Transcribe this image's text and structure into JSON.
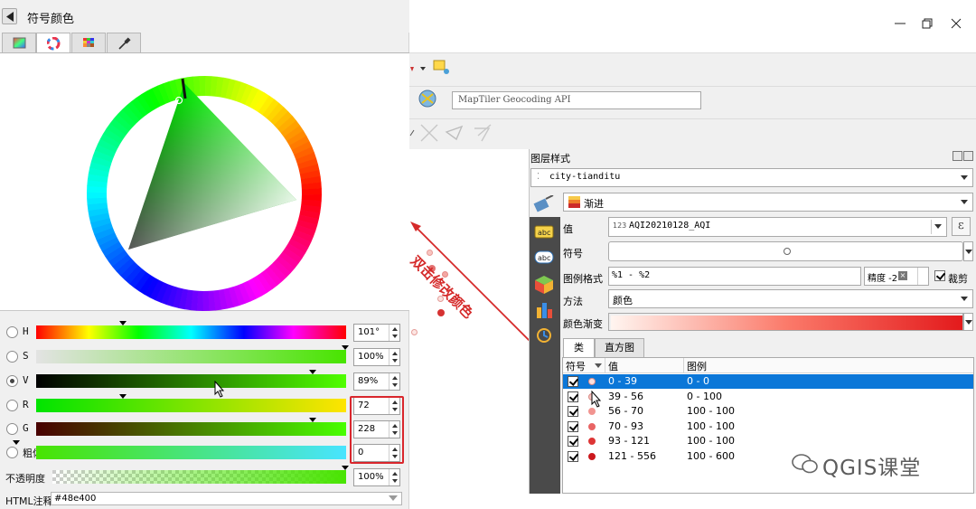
{
  "dialog": {
    "title": "符号颜色",
    "sliders": [
      {
        "label": "H",
        "value": "101°",
        "checked": false,
        "level": 0.28
      },
      {
        "label": "S",
        "value": "100%",
        "checked": false,
        "level": 1.0
      },
      {
        "label": "V",
        "value": "89%",
        "checked": true,
        "level": 0.89
      },
      {
        "label": "R",
        "value": "72",
        "checked": false,
        "level": 0.28
      },
      {
        "label": "G",
        "value": "228",
        "checked": false,
        "level": 0.89
      },
      {
        "label": "粗体",
        "value": "0",
        "checked": false,
        "level": 0.0
      }
    ],
    "opacity_label": "不透明度",
    "opacity_value": "100%",
    "html_label": "HTML注释",
    "html_value": "#48e400"
  },
  "toolbar": {
    "geocoding_placeholder": "MapTiler Geocoding API"
  },
  "layer_panel": {
    "title": "图层样式",
    "layer_name": "city-tianditu",
    "renderer": "渐进",
    "value_label": "值",
    "value_field_prefix": "123",
    "value_field": "AQI20210128_AQI",
    "symbol_label": "符号",
    "legend_format_label": "图例格式",
    "legend_format": "%1 - %2",
    "precision_label": "精度 -2",
    "trim_label": "裁剪",
    "method_label": "方法",
    "method_value": "颜色",
    "ramp_label": "颜色渐变",
    "tabs": [
      "类",
      "直方图"
    ],
    "table_headers": [
      "符号",
      "值",
      "图例"
    ],
    "classes": [
      {
        "value": "0 - 39",
        "legend": "0 - 0",
        "color": "#fde0dd",
        "selected": true
      },
      {
        "value": "39 - 56",
        "legend": "0 - 100",
        "color": "#f9c5c1",
        "selected": false
      },
      {
        "value": "56 - 70",
        "legend": "100 - 100",
        "color": "#f19490",
        "selected": false
      },
      {
        "value": "70 - 93",
        "legend": "100 - 100",
        "color": "#e86464",
        "selected": false
      },
      {
        "value": "93 - 121",
        "legend": "100 - 100",
        "color": "#dd3535",
        "selected": false
      },
      {
        "value": "121 - 556",
        "legend": "100 - 600",
        "color": "#cb181d",
        "selected": false
      }
    ]
  },
  "annotation": {
    "text": "双击修改颜色",
    "color": "#d52a2a"
  },
  "watermark": "QGIS课堂",
  "colors": {
    "selected_row": "#0b77d8",
    "current_color": "#48e400"
  }
}
